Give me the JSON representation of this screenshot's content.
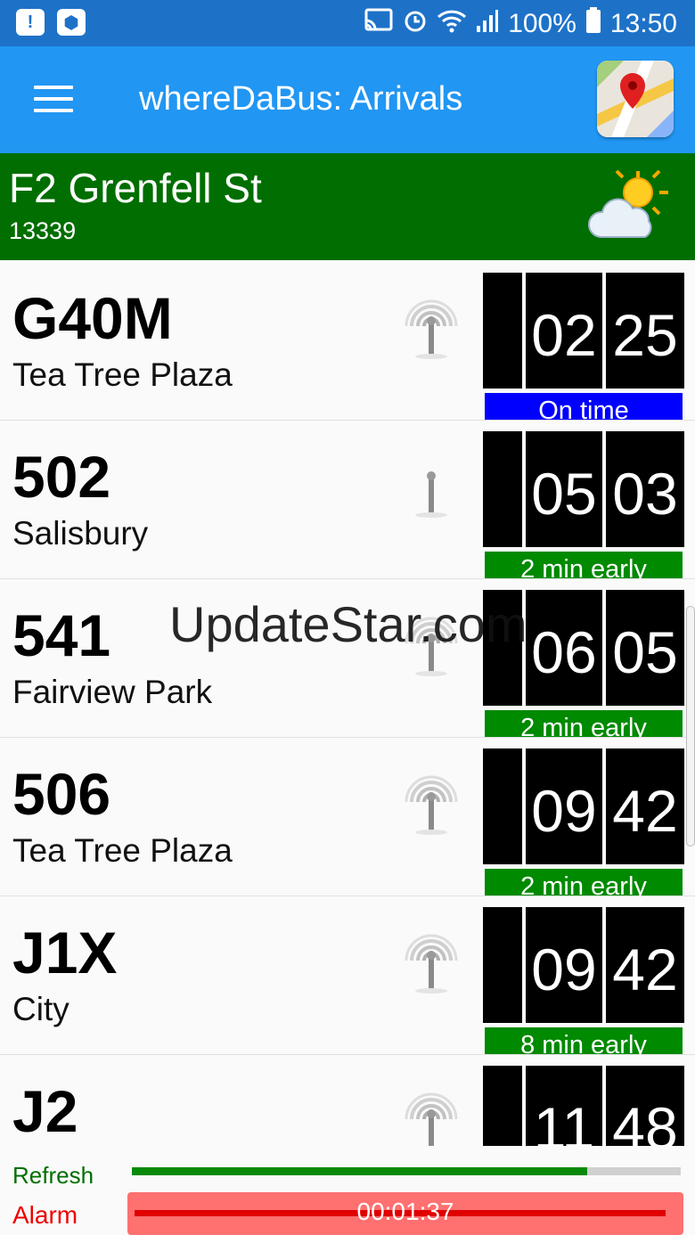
{
  "status_bar": {
    "battery": "100%",
    "time": "13:50"
  },
  "app_bar": {
    "title": "whereDaBus: Arrivals"
  },
  "stop": {
    "name": "F2 Grenfell St",
    "id": "13339"
  },
  "arrivals": [
    {
      "route": "G40M",
      "destination": "Tea Tree Plaza",
      "hours": "02",
      "minutes": "25",
      "status": "On time",
      "status_color": "#0000ff",
      "signal": "live"
    },
    {
      "route": "502",
      "destination": "Salisbury",
      "hours": "05",
      "minutes": "03",
      "status": "2 min early",
      "status_color": "#008a00",
      "signal": "none"
    },
    {
      "route": "541",
      "destination": "Fairview Park",
      "hours": "06",
      "minutes": "05",
      "status": "2 min early",
      "status_color": "#008a00",
      "signal": "live"
    },
    {
      "route": "506",
      "destination": "Tea Tree Plaza",
      "hours": "09",
      "minutes": "42",
      "status": "2 min early",
      "status_color": "#008a00",
      "signal": "live"
    },
    {
      "route": "J1X",
      "destination": "City",
      "hours": "09",
      "minutes": "42",
      "status": "8 min early",
      "status_color": "#008a00",
      "signal": "live"
    },
    {
      "route": "J2",
      "destination": "",
      "hours": "11",
      "minutes": "48",
      "status": "",
      "status_color": "#008a00",
      "signal": "live"
    }
  ],
  "bottom": {
    "refresh_label": "Refresh",
    "refresh_progress": 0.83,
    "alarm_label": "Alarm",
    "alarm_time": "00:01:37",
    "alarm_progress": 0.98
  },
  "watermark": "UpdateStar.com",
  "colors": {
    "status_bar": "#1d72c8",
    "app_bar": "#2196f3",
    "stop_header": "#006e00"
  }
}
